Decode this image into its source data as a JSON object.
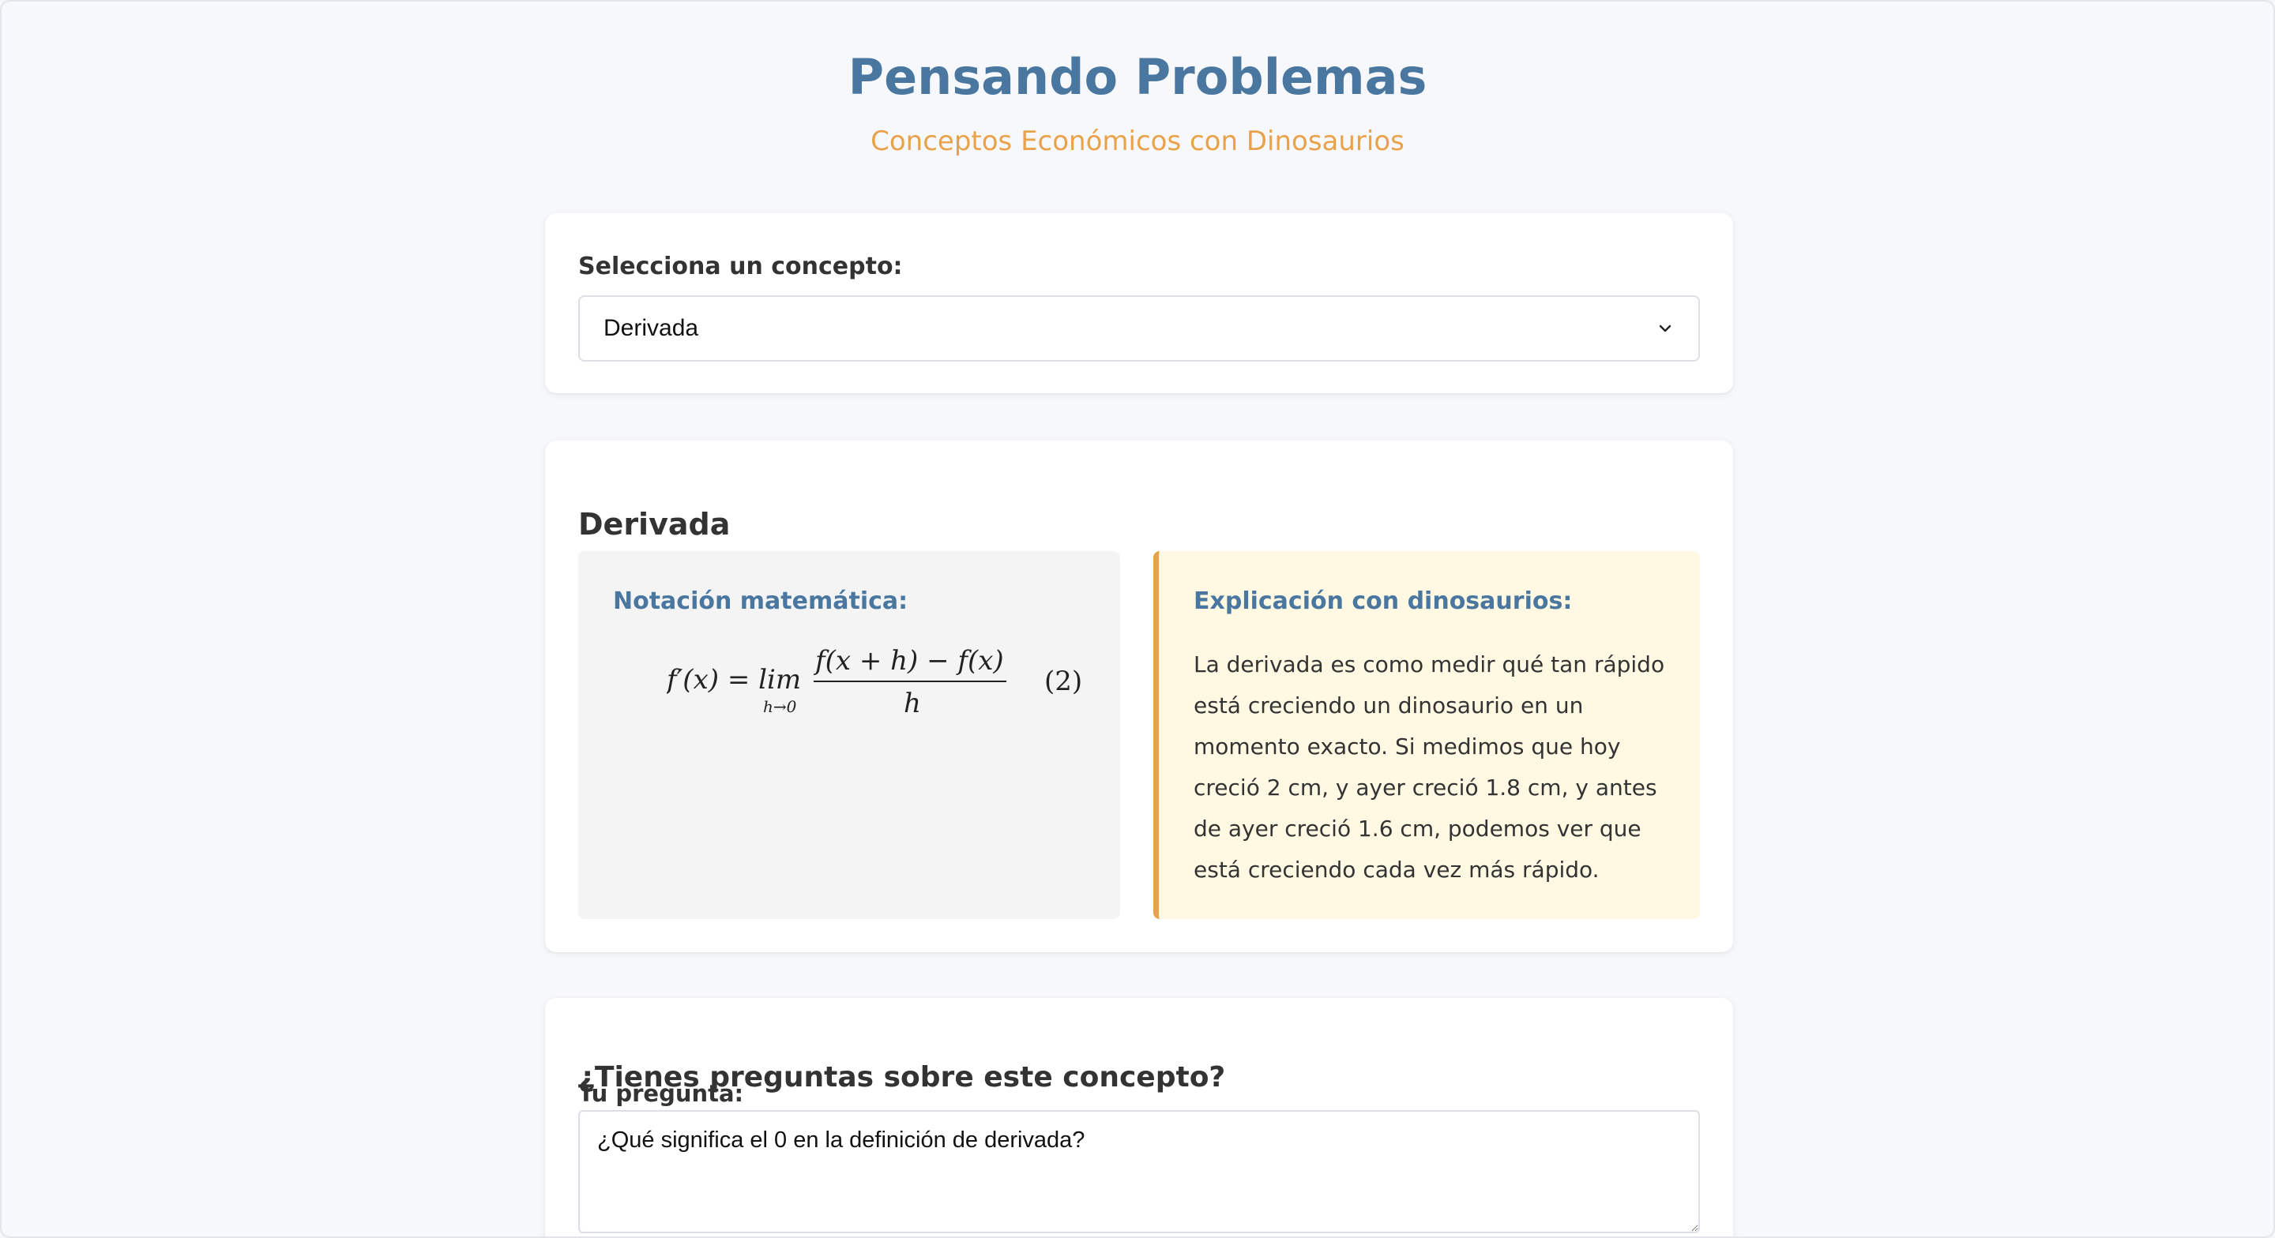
{
  "header": {
    "title": "Pensando Problemas",
    "subtitle": "Conceptos Económicos con Dinosaurios"
  },
  "selector": {
    "label": "Selecciona un concepto:",
    "selected": "Derivada"
  },
  "concept": {
    "title": "Derivada",
    "math_heading": "Notación matemática:",
    "formula": {
      "lhs": "f′(x) = lim",
      "limit_sub": "h→0",
      "numerator": "f(x + h) − f(x)",
      "denominator": "h",
      "equation_number": "(2)"
    },
    "dino_heading": "Explicación con dinosaurios:",
    "dino_text": "La derivada es como medir qué tan rápido está creciendo un dinosaurio en un momento exacto. Si medimos que hoy creció 2 cm, y ayer creció 1.8 cm, y antes de ayer creció 1.6 cm, podemos ver que está creciendo cada vez más rápido."
  },
  "question": {
    "title": "¿Tienes preguntas sobre este concepto?",
    "label": "Tu pregunta:",
    "value": "¿Qué significa el 0 en la definición de derivada?"
  },
  "colors": {
    "title": "#4a77a0",
    "accent": "#e9a24a",
    "math_panel": "#f4f4f4",
    "dino_panel": "#fff8e3"
  },
  "icons": {
    "select_arrow": "chevron-down-icon"
  }
}
